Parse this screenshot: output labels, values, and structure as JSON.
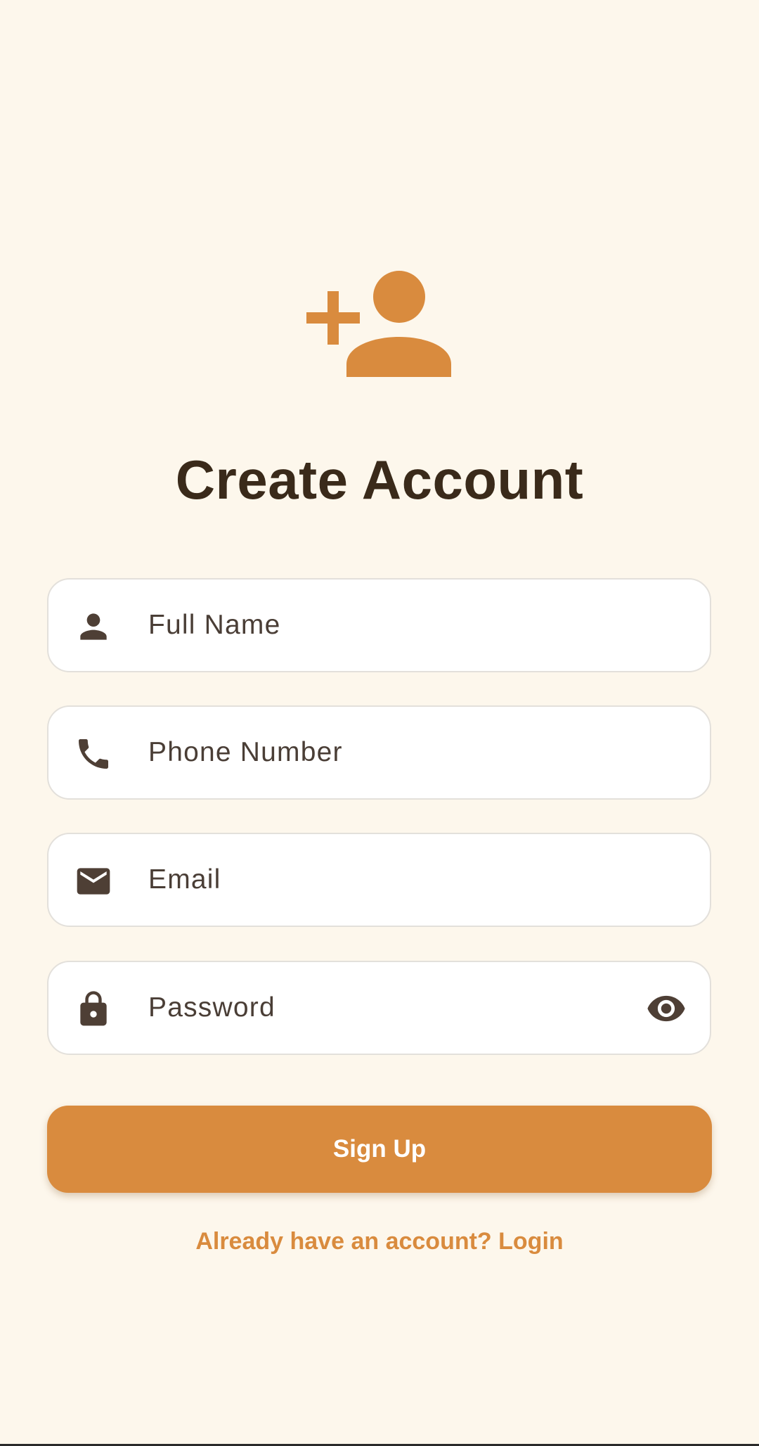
{
  "header": {
    "icon": "person-add-icon",
    "title": "Create Account"
  },
  "form": {
    "full_name": {
      "placeholder": "Full Name",
      "icon": "person-icon"
    },
    "phone": {
      "placeholder": "Phone Number",
      "icon": "phone-icon"
    },
    "email": {
      "placeholder": "Email",
      "icon": "mail-icon"
    },
    "password": {
      "placeholder": "Password",
      "icon": "lock-icon",
      "toggle_icon": "eye-icon"
    }
  },
  "actions": {
    "signup_label": "Sign Up",
    "login_link": "Already have an account? Login"
  },
  "colors": {
    "background": "#FDF7EC",
    "accent": "#D98B3E",
    "title": "#3A2A1A",
    "icon": "#4E3F35",
    "field_border": "#E3E0DB"
  }
}
